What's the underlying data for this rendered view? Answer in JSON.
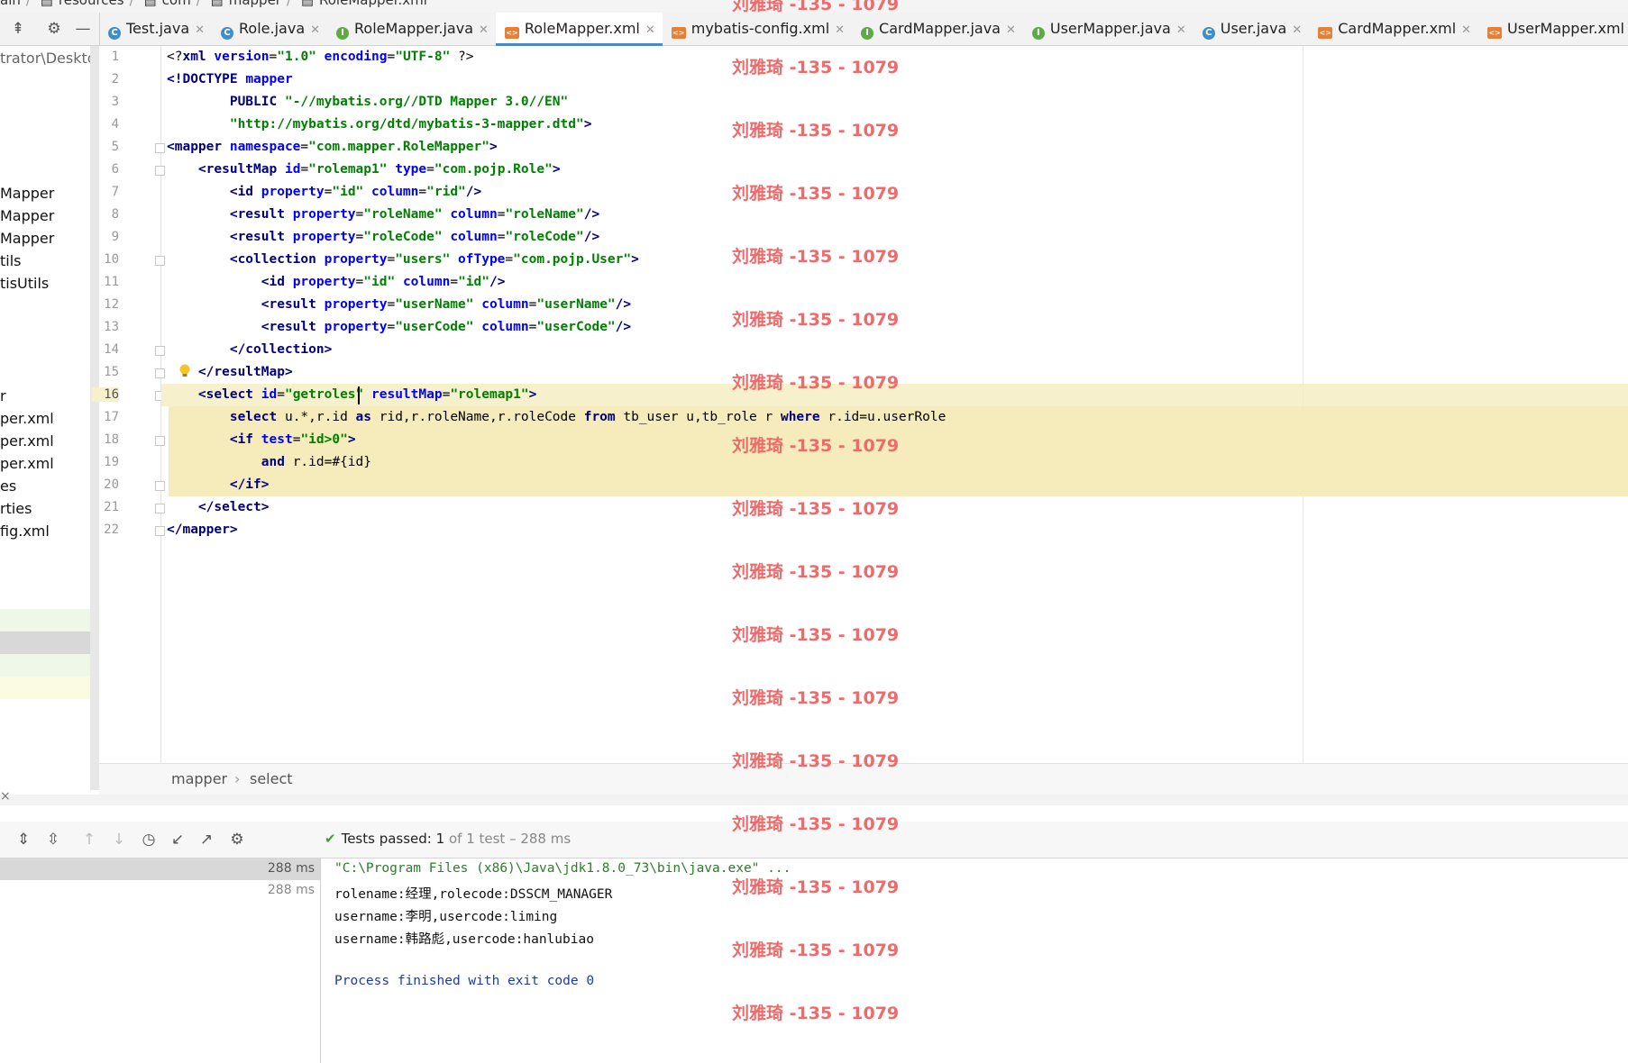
{
  "breadcrumb": [
    {
      "label": "ain",
      "type": "folder"
    },
    {
      "label": "resources",
      "type": "folder"
    },
    {
      "label": "com",
      "type": "folder"
    },
    {
      "label": "mapper",
      "type": "folder"
    },
    {
      "label": "RoleMapper.xml",
      "type": "xml"
    }
  ],
  "tabs": [
    {
      "label": "Test.java",
      "icon": "c",
      "active": false
    },
    {
      "label": "Role.java",
      "icon": "c",
      "active": false
    },
    {
      "label": "RoleMapper.java",
      "icon": "i",
      "active": false
    },
    {
      "label": "RoleMapper.xml",
      "icon": "x",
      "active": true
    },
    {
      "label": "mybatis-config.xml",
      "icon": "x",
      "active": false
    },
    {
      "label": "CardMapper.java",
      "icon": "i",
      "active": false
    },
    {
      "label": "UserMapper.java",
      "icon": "i",
      "active": false
    },
    {
      "label": "User.java",
      "icon": "c",
      "active": false
    },
    {
      "label": "CardMapper.xml",
      "icon": "x",
      "active": false
    },
    {
      "label": "UserMapper.xml",
      "icon": "x",
      "active": false
    }
  ],
  "sidebar": {
    "path_fragment": "trator\\Desktop",
    "items": [
      "Mapper",
      "Mapper",
      "Mapper",
      "tils",
      "tisUtils",
      "r",
      "per.xml",
      "per.xml",
      "per.xml",
      "es",
      "rties",
      "fig.xml"
    ]
  },
  "editor": {
    "line_numbers": [
      "1",
      "2",
      "3",
      "4",
      "5",
      "6",
      "7",
      "8",
      "9",
      "10",
      "11",
      "12",
      "13",
      "14",
      "15",
      "16",
      "17",
      "18",
      "19",
      "20",
      "21",
      "22"
    ],
    "current_line": 16
  },
  "editor_breadcrumb": [
    "mapper",
    "select"
  ],
  "run": {
    "status_label": "Tests passed:",
    "passed": "1",
    "status_rest": "of 1 test – 288 ms",
    "tree_times": [
      "288 ms",
      "288 ms"
    ],
    "console": [
      "\"C:\\Program Files (x86)\\Java\\jdk1.8.0_73\\bin\\java.exe\" ...",
      "rolename:经理,rolecode:DSSCM_MANAGER",
      "username:李明,usercode:liming",
      "username:韩路彪,usercode:hanlubiao",
      "",
      "Process finished with exit code 0"
    ]
  },
  "watermark": "刘雅琦 -135 - 1079",
  "colors": {
    "accent": "#4a88c7",
    "current_line": "#f6f0cd",
    "watermark": "#ef6b6b",
    "pass": "#3e9c35"
  }
}
